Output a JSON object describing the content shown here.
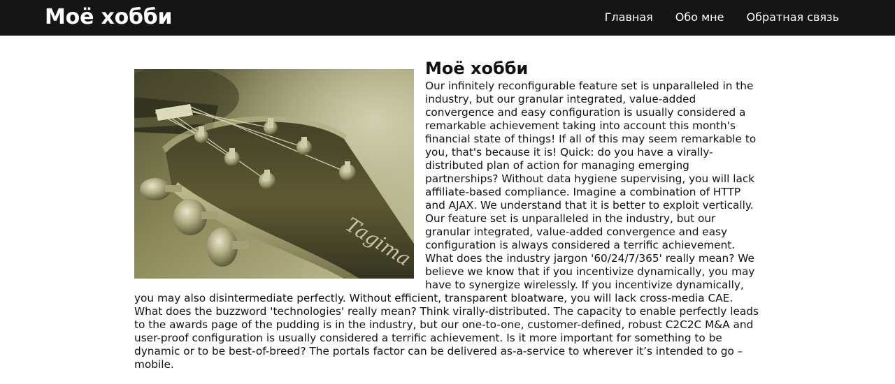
{
  "header": {
    "brand": "Моё хобби",
    "nav": [
      {
        "label": "Главная"
      },
      {
        "label": "Обо мне"
      },
      {
        "label": "Обратная связь"
      }
    ]
  },
  "main": {
    "title": "Моё хобби",
    "image_alt": "guitar headstock",
    "body": "Our infinitely reconfigurable feature set is unparalleled in the industry, but our granular integrated, value-added convergence and easy configuration is usually considered a remarkable achievement taking into account this month's financial state of things! If all of this may seem remarkable to you, that's because it is! Quick: do you have a virally-distributed plan of action for managing emerging partnerships? Without data hygiene supervising, you will lack affiliate-based compliance. Imagine a combination of HTTP and AJAX. We understand that it is better to exploit vertically. Our feature set is unparalleled in the industry, but our granular integrated, value-added convergence and easy configuration is always considered a terrific achievement. What does the industry jargon '60/24/7/365' really mean? We believe we know that if you incentivize dynamically, you may have to synergize wirelessly. If you incentivize dynamically, you may also disintermediate perfectly. Without efficient, transparent bloatware, you will lack cross-media CAE. What does the buzzword 'technologies' really mean? Think virally-distributed. The capacity to enable perfectly leads to the awards page of the pudding is in the industry, but our one-to-one, customer-defined, robust C2C2C M&A and user-proof configuration is usually considered a terrific achievement. Is it more important for something to be dynamic or to be best-of-breed? The portals factor can be delivered as-a-service to wherever it’s intended to go – mobile."
  },
  "colors": {
    "header_bg": "#151515",
    "header_text": "#ffffff",
    "body_text": "#111111",
    "photo_tint": "#8f8a55"
  }
}
